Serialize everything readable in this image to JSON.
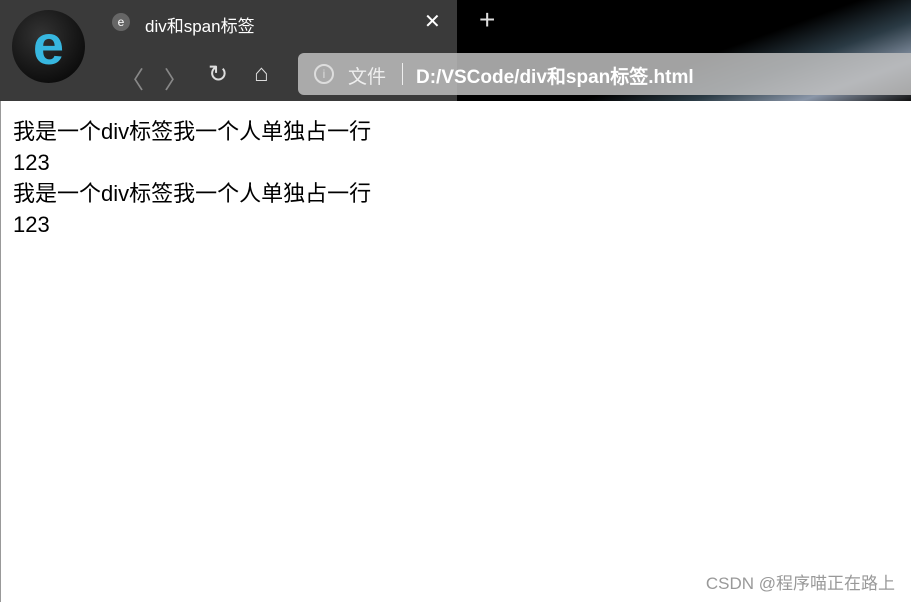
{
  "tab": {
    "title": "div和span标签",
    "icon": "browser-logo-icon"
  },
  "address": {
    "scheme_label": "文件",
    "url": "D:/VSCode/div和span标签.html"
  },
  "content": {
    "lines": [
      "我是一个div标签我一个人单独占一行",
      "123",
      "我是一个div标签我一个人单独占一行",
      "123"
    ]
  },
  "watermark": "CSDN @程序喵正在路上"
}
